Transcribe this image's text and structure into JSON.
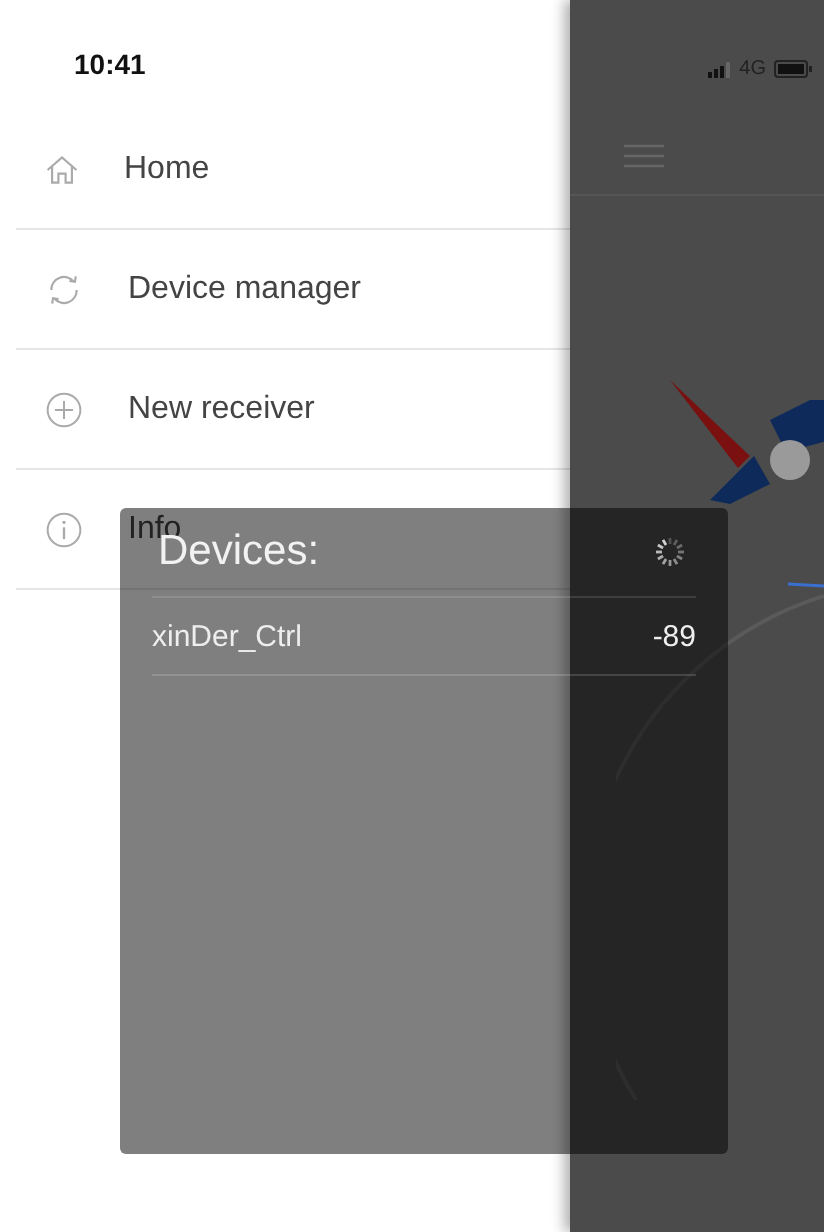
{
  "status_bar": {
    "time": "10:41",
    "network": "4G"
  },
  "drawer": {
    "items": [
      {
        "label": "Home",
        "kind": "home"
      },
      {
        "label": "Device manager",
        "kind": "sync"
      },
      {
        "label": "New receiver",
        "kind": "add"
      },
      {
        "label": "Info",
        "kind": "info"
      }
    ]
  },
  "devices_dialog": {
    "title": "Devices:",
    "scanning": true,
    "devices": [
      {
        "name": "xinDer_Ctrl",
        "rssi": "-89"
      }
    ]
  }
}
